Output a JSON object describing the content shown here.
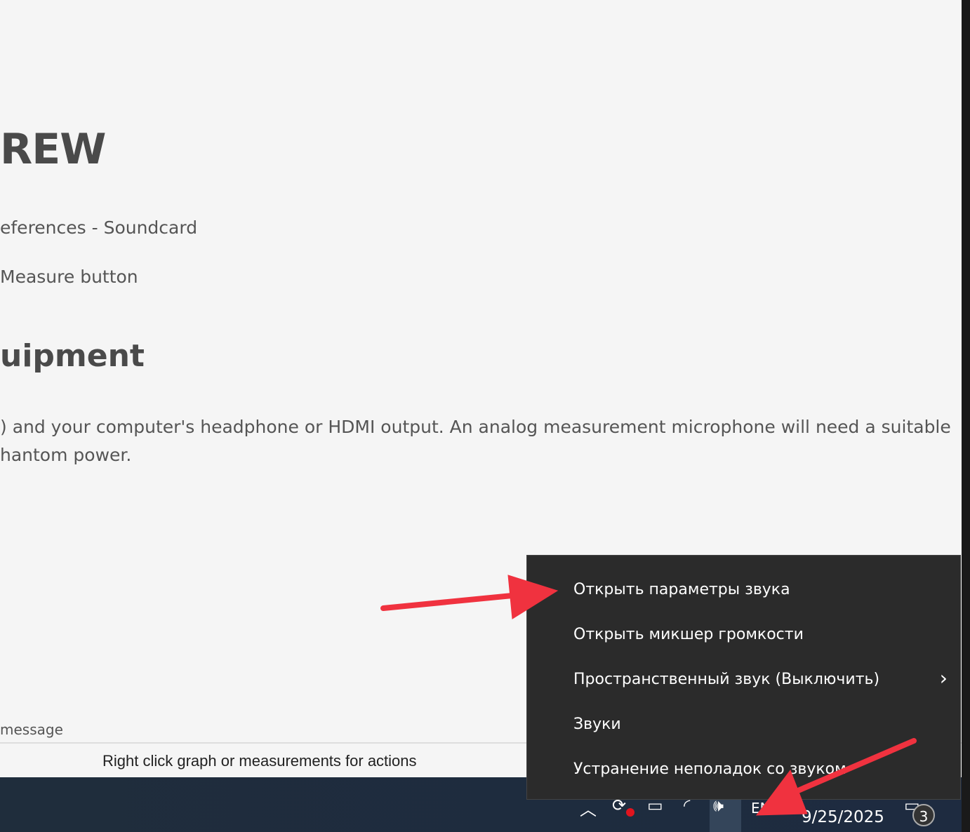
{
  "document": {
    "heading": "REW",
    "step1": "eferences - Soundcard",
    "step2": "Measure button",
    "heading2": "uipment",
    "para_line1": ") and your computer's headphone or HDMI output. An analog measurement microphone will need a suitable",
    "para_line2": "hantom power.",
    "message": "message"
  },
  "status_bar": {
    "text": "Right click graph or measurements for actions"
  },
  "context_menu": {
    "items": [
      {
        "label": "Открыть параметры звука"
      },
      {
        "label": "Открыть микшер громкости"
      },
      {
        "label": "Пространственный звук (Выключить)",
        "submenu": true
      },
      {
        "label": "Звуки"
      },
      {
        "label": "Устранение неполадок со звуком"
      }
    ]
  },
  "taskbar": {
    "date": "9/25/2025",
    "language": "EN",
    "notification_count": "3"
  },
  "colors": {
    "arrow": "#f0323f",
    "menu_bg": "#2b2b2b"
  }
}
